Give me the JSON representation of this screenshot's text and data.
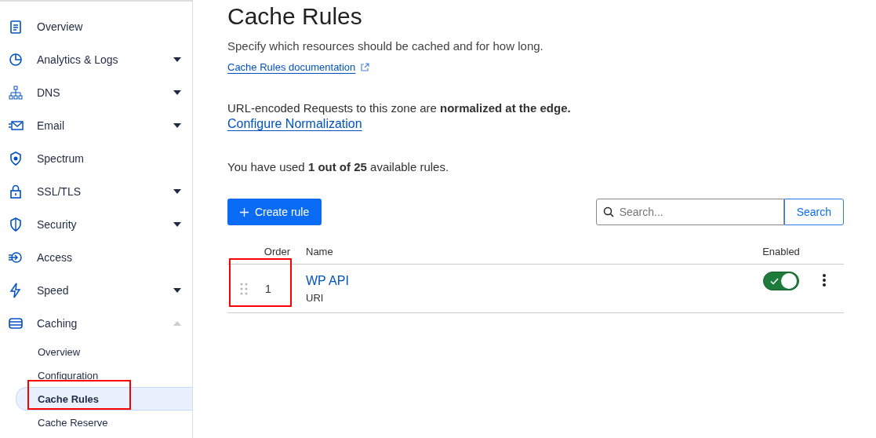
{
  "sidebar": {
    "items": [
      {
        "label": "Overview"
      },
      {
        "label": "Analytics & Logs",
        "expanded": false
      },
      {
        "label": "DNS",
        "expanded": false
      },
      {
        "label": "Email",
        "expanded": false
      },
      {
        "label": "Spectrum"
      },
      {
        "label": "SSL/TLS",
        "expanded": false
      },
      {
        "label": "Security",
        "expanded": false
      },
      {
        "label": "Access"
      },
      {
        "label": "Speed",
        "expanded": false
      },
      {
        "label": "Caching",
        "expanded": true,
        "children": [
          {
            "label": "Overview",
            "selected": false,
            "highlighted": false
          },
          {
            "label": "Configuration",
            "selected": false,
            "highlighted": false
          },
          {
            "label": "Cache Rules",
            "selected": true,
            "highlighted": true
          },
          {
            "label": "Cache Reserve",
            "selected": false,
            "highlighted": false
          }
        ]
      }
    ]
  },
  "page": {
    "title": "Cache Rules",
    "subtitle": "Specify which resources should be cached and for how long.",
    "doc_link": "Cache Rules documentation",
    "notice": "URL-encoded Requests to this zone are **normalized at the edge.**",
    "notice_link": "Configure Normalization",
    "usage": "You have used **1 out of 25** available rules."
  },
  "toolbar": {
    "create_button": "Create rule",
    "search": {
      "placeholder": "Search..."
    },
    "search_button": "Search"
  },
  "table": {
    "columns": [
      "Order",
      "Name",
      "Enabled"
    ],
    "rows": [
      {
        "order": "1",
        "name": "WP API",
        "subtitle": "URI",
        "enabled": true,
        "highlighted": true
      }
    ]
  }
}
